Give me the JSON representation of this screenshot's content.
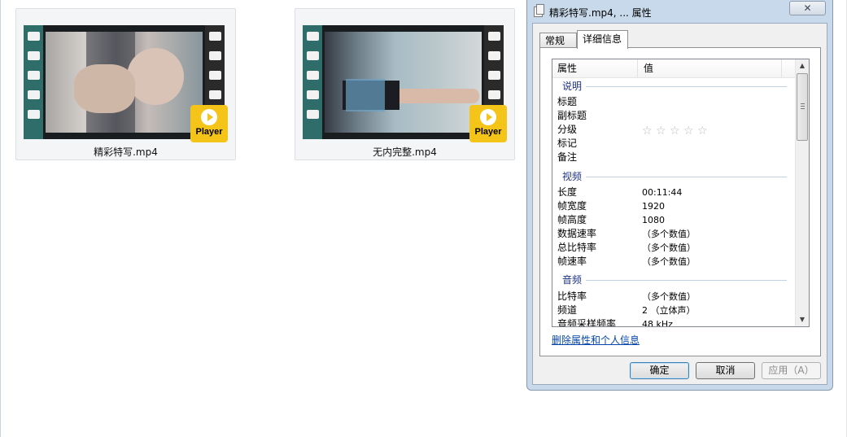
{
  "files": [
    {
      "name": "精彩特写.mp4",
      "badge": "Player"
    },
    {
      "name": "无内完整.mp4",
      "badge": "Player"
    }
  ],
  "dialog": {
    "title": "精彩特写.mp4, ... 属性",
    "close_glyph": "✕",
    "tabs": {
      "general": "常规",
      "details": "详细信息"
    },
    "columns": {
      "property": "属性",
      "value": "值"
    },
    "groups": {
      "description": "说明",
      "video": "视频",
      "audio": "音频"
    },
    "description_rows": [
      {
        "key": "标题",
        "value": ""
      },
      {
        "key": "副标题",
        "value": ""
      },
      {
        "key": "分级",
        "value": ""
      },
      {
        "key": "标记",
        "value": ""
      },
      {
        "key": "备注",
        "value": ""
      }
    ],
    "rating": {
      "stars_total": 5,
      "stars_filled": 0,
      "star_glyph": "☆"
    },
    "video_rows": [
      {
        "key": "长度",
        "value": "00:11:44"
      },
      {
        "key": "帧宽度",
        "value": "1920"
      },
      {
        "key": "帧高度",
        "value": "1080"
      },
      {
        "key": "数据速率",
        "value": "（多个数值）"
      },
      {
        "key": "总比特率",
        "value": "（多个数值）"
      },
      {
        "key": "帧速率",
        "value": "（多个数值）"
      }
    ],
    "audio_rows": [
      {
        "key": "比特率",
        "value": "（多个数值）"
      },
      {
        "key": "频道",
        "value": "2 （立体声）"
      },
      {
        "key": "音频采样频率",
        "value": "48 kHz"
      }
    ],
    "scroll": {
      "up": "▲",
      "down": "▼"
    },
    "remove_link": "删除属性和个人信息",
    "buttons": {
      "ok": "确定",
      "cancel": "取消",
      "apply": "应用（A）"
    }
  }
}
